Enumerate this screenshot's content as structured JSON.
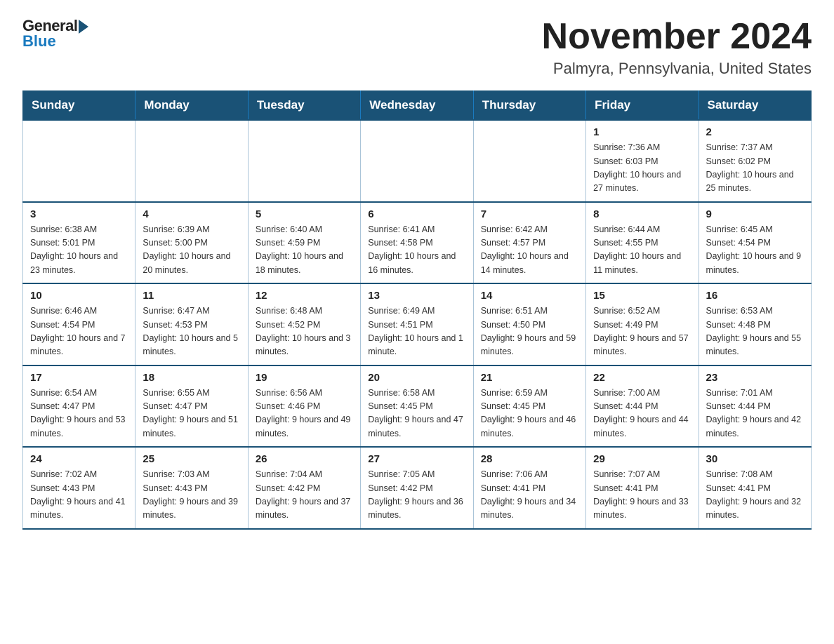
{
  "header": {
    "logo_general": "General",
    "logo_blue": "Blue",
    "month_title": "November 2024",
    "location": "Palmyra, Pennsylvania, United States"
  },
  "weekdays": [
    "Sunday",
    "Monday",
    "Tuesday",
    "Wednesday",
    "Thursday",
    "Friday",
    "Saturday"
  ],
  "weeks": [
    [
      {
        "day": "",
        "info": ""
      },
      {
        "day": "",
        "info": ""
      },
      {
        "day": "",
        "info": ""
      },
      {
        "day": "",
        "info": ""
      },
      {
        "day": "",
        "info": ""
      },
      {
        "day": "1",
        "info": "Sunrise: 7:36 AM\nSunset: 6:03 PM\nDaylight: 10 hours and 27 minutes."
      },
      {
        "day": "2",
        "info": "Sunrise: 7:37 AM\nSunset: 6:02 PM\nDaylight: 10 hours and 25 minutes."
      }
    ],
    [
      {
        "day": "3",
        "info": "Sunrise: 6:38 AM\nSunset: 5:01 PM\nDaylight: 10 hours and 23 minutes."
      },
      {
        "day": "4",
        "info": "Sunrise: 6:39 AM\nSunset: 5:00 PM\nDaylight: 10 hours and 20 minutes."
      },
      {
        "day": "5",
        "info": "Sunrise: 6:40 AM\nSunset: 4:59 PM\nDaylight: 10 hours and 18 minutes."
      },
      {
        "day": "6",
        "info": "Sunrise: 6:41 AM\nSunset: 4:58 PM\nDaylight: 10 hours and 16 minutes."
      },
      {
        "day": "7",
        "info": "Sunrise: 6:42 AM\nSunset: 4:57 PM\nDaylight: 10 hours and 14 minutes."
      },
      {
        "day": "8",
        "info": "Sunrise: 6:44 AM\nSunset: 4:55 PM\nDaylight: 10 hours and 11 minutes."
      },
      {
        "day": "9",
        "info": "Sunrise: 6:45 AM\nSunset: 4:54 PM\nDaylight: 10 hours and 9 minutes."
      }
    ],
    [
      {
        "day": "10",
        "info": "Sunrise: 6:46 AM\nSunset: 4:54 PM\nDaylight: 10 hours and 7 minutes."
      },
      {
        "day": "11",
        "info": "Sunrise: 6:47 AM\nSunset: 4:53 PM\nDaylight: 10 hours and 5 minutes."
      },
      {
        "day": "12",
        "info": "Sunrise: 6:48 AM\nSunset: 4:52 PM\nDaylight: 10 hours and 3 minutes."
      },
      {
        "day": "13",
        "info": "Sunrise: 6:49 AM\nSunset: 4:51 PM\nDaylight: 10 hours and 1 minute."
      },
      {
        "day": "14",
        "info": "Sunrise: 6:51 AM\nSunset: 4:50 PM\nDaylight: 9 hours and 59 minutes."
      },
      {
        "day": "15",
        "info": "Sunrise: 6:52 AM\nSunset: 4:49 PM\nDaylight: 9 hours and 57 minutes."
      },
      {
        "day": "16",
        "info": "Sunrise: 6:53 AM\nSunset: 4:48 PM\nDaylight: 9 hours and 55 minutes."
      }
    ],
    [
      {
        "day": "17",
        "info": "Sunrise: 6:54 AM\nSunset: 4:47 PM\nDaylight: 9 hours and 53 minutes."
      },
      {
        "day": "18",
        "info": "Sunrise: 6:55 AM\nSunset: 4:47 PM\nDaylight: 9 hours and 51 minutes."
      },
      {
        "day": "19",
        "info": "Sunrise: 6:56 AM\nSunset: 4:46 PM\nDaylight: 9 hours and 49 minutes."
      },
      {
        "day": "20",
        "info": "Sunrise: 6:58 AM\nSunset: 4:45 PM\nDaylight: 9 hours and 47 minutes."
      },
      {
        "day": "21",
        "info": "Sunrise: 6:59 AM\nSunset: 4:45 PM\nDaylight: 9 hours and 46 minutes."
      },
      {
        "day": "22",
        "info": "Sunrise: 7:00 AM\nSunset: 4:44 PM\nDaylight: 9 hours and 44 minutes."
      },
      {
        "day": "23",
        "info": "Sunrise: 7:01 AM\nSunset: 4:44 PM\nDaylight: 9 hours and 42 minutes."
      }
    ],
    [
      {
        "day": "24",
        "info": "Sunrise: 7:02 AM\nSunset: 4:43 PM\nDaylight: 9 hours and 41 minutes."
      },
      {
        "day": "25",
        "info": "Sunrise: 7:03 AM\nSunset: 4:43 PM\nDaylight: 9 hours and 39 minutes."
      },
      {
        "day": "26",
        "info": "Sunrise: 7:04 AM\nSunset: 4:42 PM\nDaylight: 9 hours and 37 minutes."
      },
      {
        "day": "27",
        "info": "Sunrise: 7:05 AM\nSunset: 4:42 PM\nDaylight: 9 hours and 36 minutes."
      },
      {
        "day": "28",
        "info": "Sunrise: 7:06 AM\nSunset: 4:41 PM\nDaylight: 9 hours and 34 minutes."
      },
      {
        "day": "29",
        "info": "Sunrise: 7:07 AM\nSunset: 4:41 PM\nDaylight: 9 hours and 33 minutes."
      },
      {
        "day": "30",
        "info": "Sunrise: 7:08 AM\nSunset: 4:41 PM\nDaylight: 9 hours and 32 minutes."
      }
    ]
  ]
}
